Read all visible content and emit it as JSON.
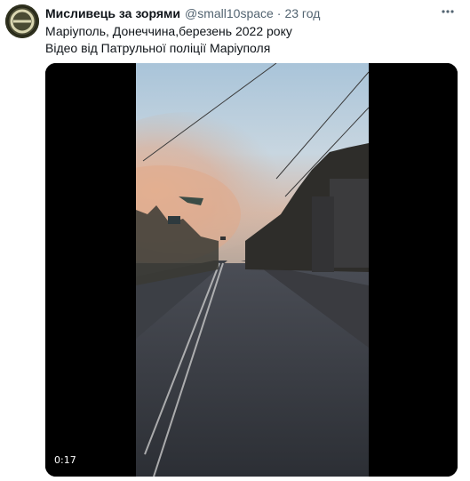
{
  "tweet": {
    "author_name": "Мисливець за зорями",
    "handle": "@small10space",
    "separator": "·",
    "time": "23 год",
    "text_lines": [
      "Маріуполь, Донеччина,березень 2022 року",
      "Відео від Патрульної поліції Маріуполя"
    ],
    "more_icon": "more-horizontal-icon",
    "avatar_icon": "profile-avatar"
  },
  "video": {
    "duration": "0:17"
  }
}
